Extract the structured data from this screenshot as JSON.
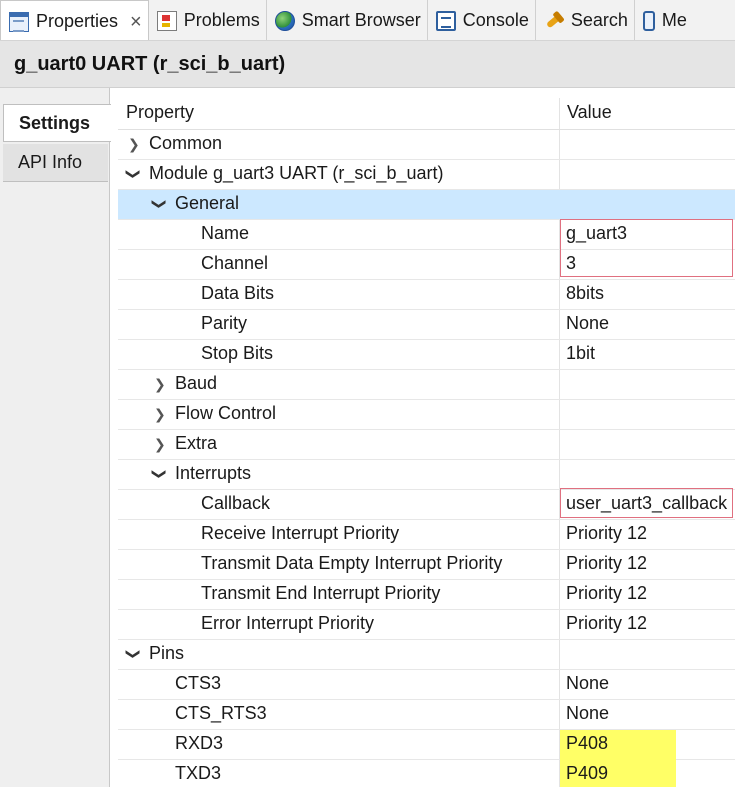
{
  "tabs": [
    {
      "label": "Properties",
      "icon": "properties-icon",
      "active": true
    },
    {
      "label": "Problems",
      "icon": "problems-icon"
    },
    {
      "label": "Smart Browser",
      "icon": "smart-browser-icon"
    },
    {
      "label": "Console",
      "icon": "console-icon"
    },
    {
      "label": "Search",
      "icon": "search-icon"
    },
    {
      "label": "Me",
      "icon": "memory-icon"
    }
  ],
  "close_glyph": "×",
  "title": "g_uart0 UART (r_sci_b_uart)",
  "side_tabs": {
    "settings": "Settings",
    "api_info": "API Info"
  },
  "columns": {
    "property": "Property",
    "value": "Value"
  },
  "rows": [
    {
      "label": "Common",
      "value": ""
    },
    {
      "label": "Module g_uart3 UART (r_sci_b_uart)",
      "value": ""
    },
    {
      "label": "General",
      "value": ""
    },
    {
      "label": "Name",
      "value": "g_uart3"
    },
    {
      "label": "Channel",
      "value": "3"
    },
    {
      "label": "Data Bits",
      "value": "8bits"
    },
    {
      "label": "Parity",
      "value": "None"
    },
    {
      "label": "Stop Bits",
      "value": "1bit"
    },
    {
      "label": "Baud",
      "value": ""
    },
    {
      "label": "Flow Control",
      "value": ""
    },
    {
      "label": "Extra",
      "value": ""
    },
    {
      "label": "Interrupts",
      "value": ""
    },
    {
      "label": "Callback",
      "value": "user_uart3_callback"
    },
    {
      "label": "Receive Interrupt Priority",
      "value": "Priority 12"
    },
    {
      "label": "Transmit Data Empty Interrupt Priority",
      "value": "Priority 12"
    },
    {
      "label": "Transmit End Interrupt Priority",
      "value": "Priority 12"
    },
    {
      "label": "Error Interrupt Priority",
      "value": "Priority 12"
    },
    {
      "label": "Pins",
      "value": ""
    },
    {
      "label": "CTS3",
      "value": "None"
    },
    {
      "label": "CTS_RTS3",
      "value": "None"
    },
    {
      "label": "RXD3",
      "value": "P408"
    },
    {
      "label": "TXD3",
      "value": "P409"
    }
  ],
  "colors": {
    "selected_row": "#cce8ff",
    "highlight_red": "#e07080",
    "highlight_yellow": "#ffff66"
  }
}
